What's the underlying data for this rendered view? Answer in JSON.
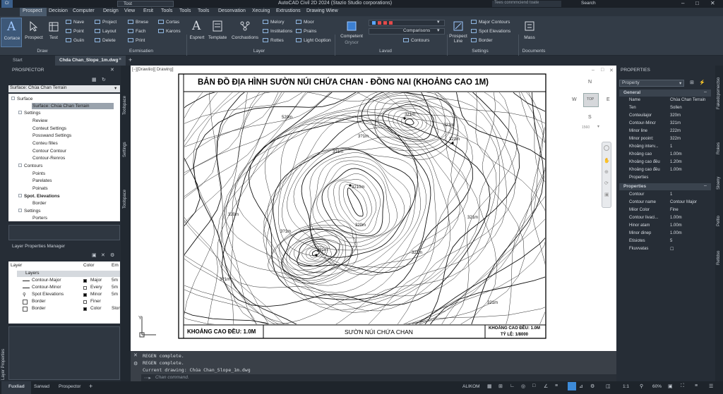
{
  "app": {
    "title": "AutoCAD Civil 2D 2024  (Stazio Studio corporations)",
    "file_tab": "Tost",
    "search_placeholder": "Tees conmmciend toate",
    "search_label": "Search",
    "app_tag": "Cr"
  },
  "menu": [
    "Prospect",
    "Decision",
    "Computer",
    "Design",
    "View",
    "Ersit",
    "Tools",
    "Tools",
    "Tools",
    "Desonvation",
    "Xecuing",
    "Extrustions",
    "Drawing Wiew"
  ],
  "ribbon": {
    "groups": [
      {
        "label": "Draw"
      },
      {
        "label": "Esrmisatien"
      },
      {
        "label": "Layer"
      },
      {
        "label": "Lavud"
      },
      {
        "label": "Settings"
      },
      {
        "label": "Documents"
      }
    ],
    "big": [
      "Cortace",
      "Prospect",
      "Test",
      "Esprert",
      "Template",
      "Corchastions",
      "Competent",
      "Prospect Line",
      "Mass"
    ],
    "big_sub": {
      "competent": "Grysor"
    },
    "small": [
      "Nave",
      "Point",
      "Guiin",
      "Project",
      "Layout",
      "Delete",
      "Brwse",
      "Fach",
      "Print",
      "Cortas",
      "Karons",
      "Melory",
      "Institations",
      "Rottes",
      "Moor",
      "Prains",
      "Light Goption",
      "Comparisons",
      "Contours",
      "Major Contours",
      "Spot Elevations",
      "Border"
    ]
  },
  "doc_tabs": [
    "Start",
    "Chda Chan_Slope_1m.dwg"
  ],
  "prospector": {
    "title": "PROSPECTOR",
    "dropdown": "Surface: Chúa Chan Terrain",
    "tree": [
      "Surface",
      "Surface: Chúa Chan Terrain",
      "Settings",
      "Review",
      "Conteut Settings",
      "Posswand Settings",
      "Conteu filles",
      "Contour Contour",
      "Contour-Renros",
      "Contours",
      "Points",
      "Parelates",
      "Poinats",
      "Spot. Elevations",
      "Border",
      "Settings",
      "Porters"
    ],
    "side_tabs": [
      "Toolspace",
      "Settings",
      "Toolspace"
    ]
  },
  "layer_manager": {
    "title": "Layer Properties Manager",
    "headers": [
      "Layer",
      "Color",
      "Em"
    ],
    "group": "Layers",
    "rows": [
      {
        "name": "Contour-Major",
        "color": "Major",
        "em": "5m",
        "swatch": "#000000"
      },
      {
        "name": "Contour-Minor",
        "color": "Every",
        "em": "5m",
        "swatch": "#ffffff"
      },
      {
        "name": "Spot Elevations",
        "color": "Minor",
        "em": "5m",
        "swatch": "#000000"
      },
      {
        "name": "Border",
        "color": "Finer",
        "em": "",
        "swatch": "#ffffff"
      },
      {
        "name": "Border",
        "color": "Color",
        "em": "Slon",
        "swatch": "#000000"
      }
    ],
    "side_label": "Layer Properties"
  },
  "viewport_label": "[−][Drawiiio][ Drawing]",
  "map": {
    "title": "BẢN ĐỒ ĐỊA HÌNH SƯỜN NÚI CHỨA CHAN - ĐỒNG NAI (KHOẢNG CAO 1M)",
    "footer_left": "KHOẢNG CAO ĐỀU: 1.0M",
    "footer_center": "SƯỜN NÚI CHỨA CHAN",
    "footer_right_top": "KHOẢNG CAO ĐỀU: 1.0M",
    "footer_right_bottom": "TỶ LỆ: 1/8000",
    "labels": [
      "321m",
      "520m",
      "321m",
      "3?1m",
      "321m",
      "3210m",
      "320m",
      "3?1m",
      "321m",
      "3?1m",
      "321m",
      "321m",
      "321m",
      "320m",
      "321m"
    ]
  },
  "viewcube": {
    "n": "N",
    "s": "S",
    "e": "E",
    "w": "W",
    "top": "TOP",
    "scale": "1560"
  },
  "properties": {
    "title": "PROPERTIES",
    "dropdown": "Property",
    "general_header": "General",
    "general": [
      [
        "Name",
        "Chúa Chan Terrain"
      ],
      [
        "Ten",
        "Sollen"
      ],
      [
        "Conteuilajor",
        "320m"
      ],
      [
        "Contour-Mincr",
        "321m"
      ],
      [
        "Minor line",
        "222m"
      ],
      [
        "Minor pooint:",
        "322m"
      ],
      [
        "Khoảng interv...",
        "1"
      ],
      [
        "Khoảng cao",
        "1.00m"
      ],
      [
        "Khoảng cao đều",
        "1.20m"
      ],
      [
        "Khoảng cao đều",
        "1.00m"
      ],
      [
        "Properties",
        ""
      ]
    ],
    "props_header": "Properties",
    "props": [
      [
        "Contour",
        "1"
      ],
      [
        "Contour name",
        "Contour Major"
      ],
      [
        "Miior Color",
        "Fine"
      ],
      [
        "Contour livaci...",
        "1.00m"
      ],
      [
        "Hinor atam",
        "1.00m"
      ],
      [
        "Minor dinep",
        "1.00m"
      ],
      [
        "Etisiotes",
        "5"
      ],
      [
        "Fkuvvatas",
        "☐"
      ]
    ],
    "side_tabs": [
      "Fakedcpsmectso",
      "Rokes",
      "Sloeny",
      "Peltio",
      "Retldso"
    ]
  },
  "command": {
    "lines": [
      "REGEN complete.",
      "REGEN complete.",
      "Current drawing: Chúa Chan_Slope_1m.dwg"
    ],
    "placeholder": "Chan command."
  },
  "status": {
    "tabs": [
      "Fuxliad",
      "Sarwad",
      "Prospector"
    ],
    "right": [
      "ALIKOM",
      "1:1",
      "60%"
    ]
  }
}
